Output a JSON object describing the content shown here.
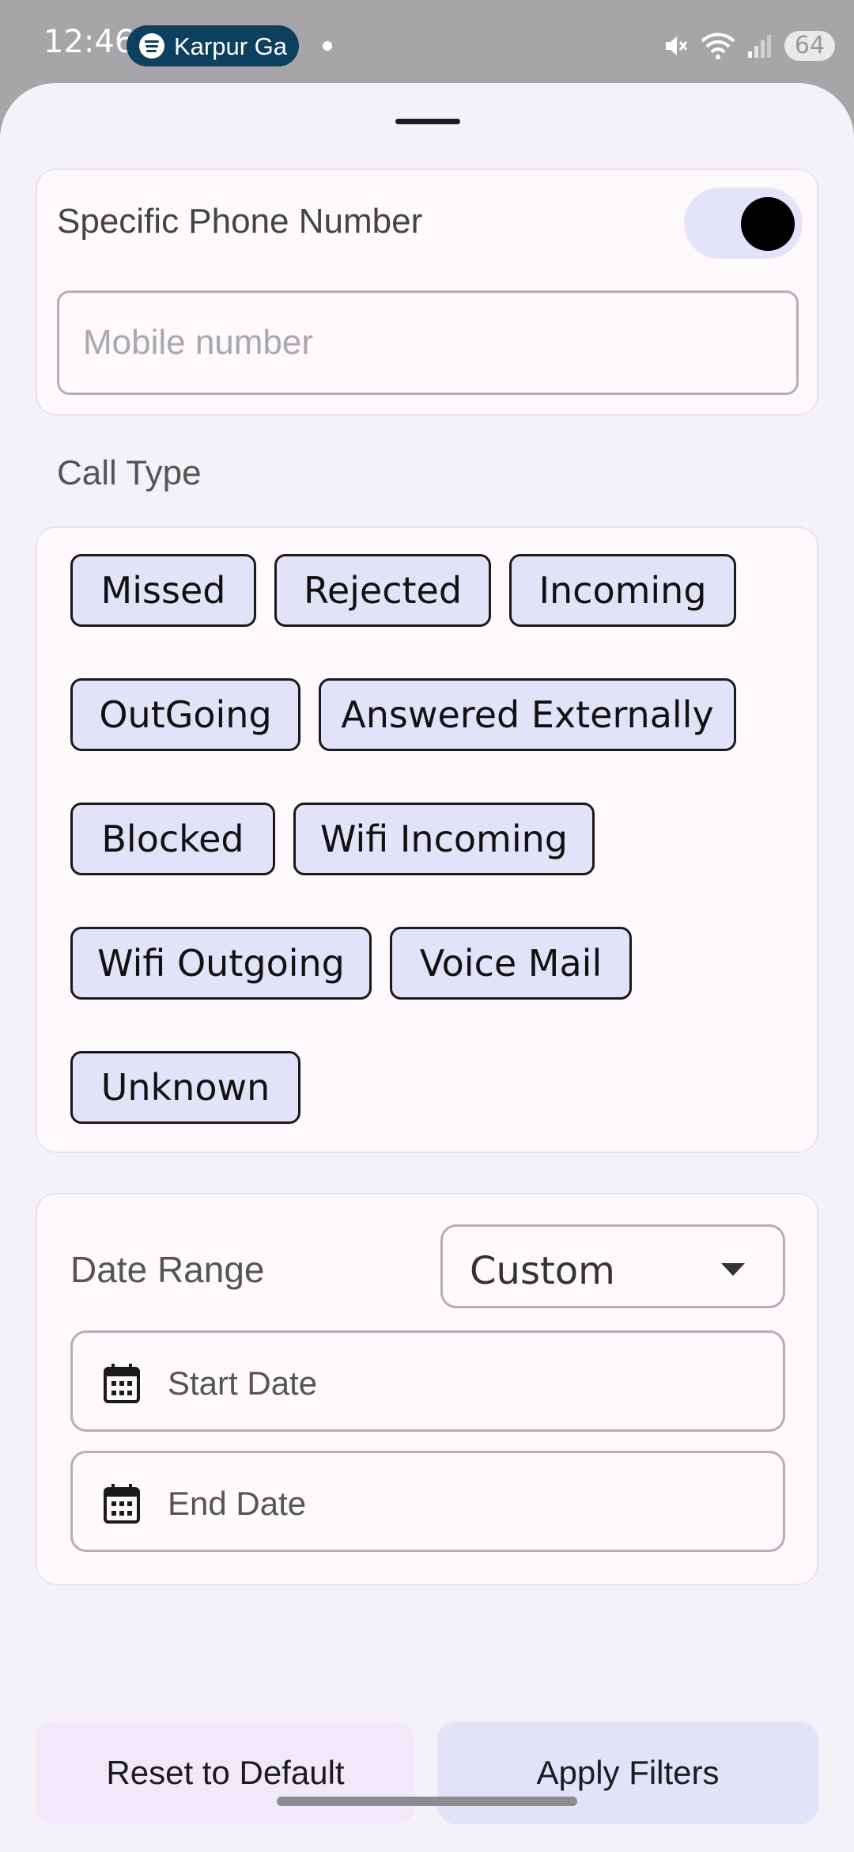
{
  "status_bar": {
    "time": "12:46",
    "media_chip_label": "Karpur Ga",
    "battery": "64",
    "icons": [
      "spotify-icon",
      "mute-icon",
      "wifi-icon",
      "signal-icon",
      "battery-icon"
    ]
  },
  "phone_filter": {
    "title": "Specific Phone Number",
    "toggle_on": true,
    "input_placeholder": "Mobile number",
    "input_value": ""
  },
  "call_type": {
    "label": "Call Type",
    "chips": [
      "Missed",
      "Rejected",
      "Incoming",
      "OutGoing",
      "Answered Externally",
      "Blocked",
      "Wifi Incoming",
      "Wifi Outgoing",
      "Voice Mail",
      "Unknown"
    ]
  },
  "date_range": {
    "label": "Date Range",
    "selected": "Custom",
    "start_placeholder": "Start Date",
    "end_placeholder": "End Date",
    "icon": "calendar-icon"
  },
  "actions": {
    "reset_label": "Reset to Default",
    "apply_label": "Apply Filters"
  },
  "colors": {
    "sheet_bg": "#f5f2f7",
    "chip_bg": "#e2e3f8",
    "toggle_track": "#e3e4f9",
    "status_bar_bg": "#a7a5a8",
    "media_chip_bg": "#0d3f5e"
  }
}
